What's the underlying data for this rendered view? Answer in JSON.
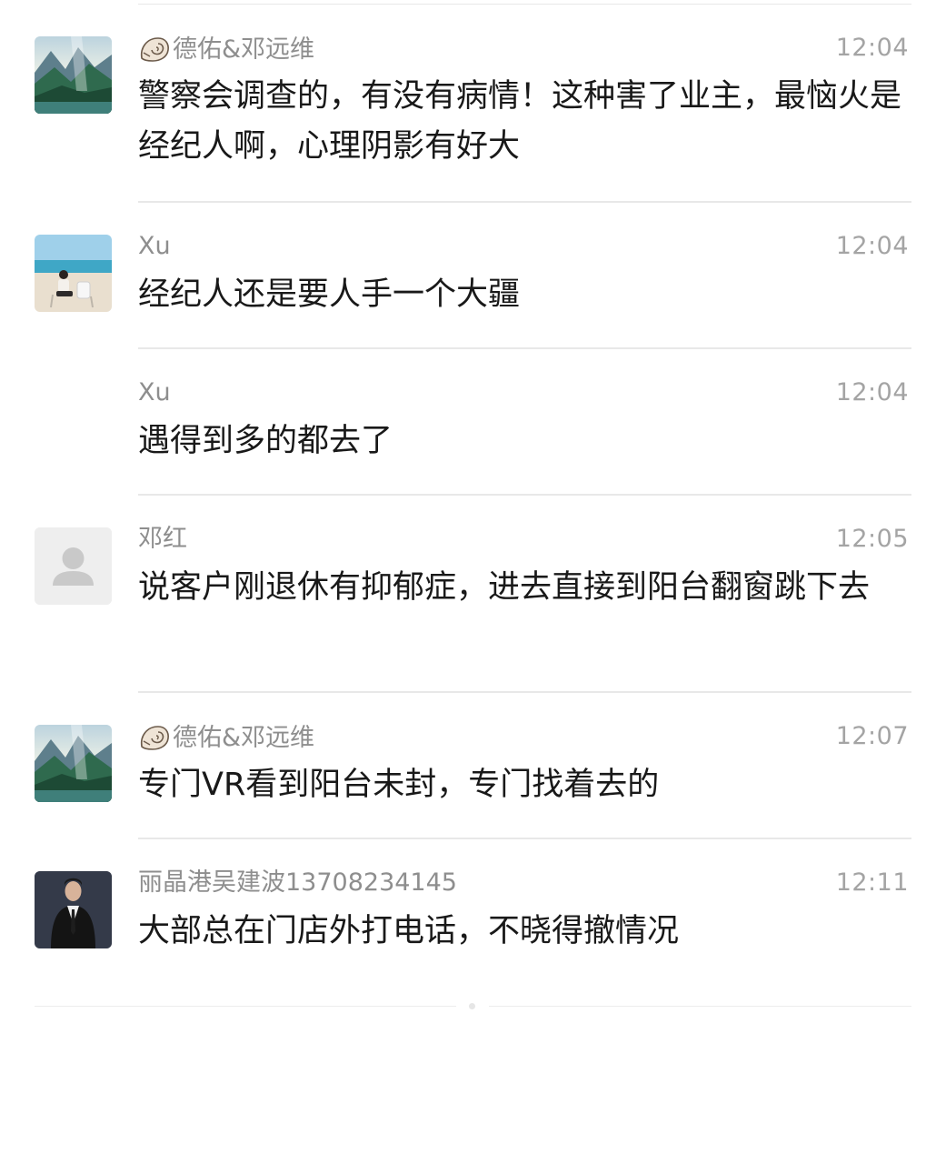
{
  "messages": [
    {
      "sender": "德佑&邓远维",
      "time": "12:04",
      "text": "警察会调查的，有没有病情！这种害了业主，最恼火是经纪人啊，心理阴影有好大",
      "avatar": "landscape-avatar",
      "sender_icon": "shell-icon"
    },
    {
      "sender": "Xu",
      "time": "12:04",
      "text": "经纪人还是要人手一个大疆",
      "avatar": "beach-avatar"
    },
    {
      "sender": "Xu",
      "time": "12:04",
      "text": "遇得到多的都去了"
    },
    {
      "sender": "邓红",
      "time": "12:05",
      "text": "说客户刚退休有抑郁症，进去直接到阳台翻窗跳下去",
      "avatar": "default-user-avatar"
    },
    {
      "sender": "德佑&邓远维",
      "time": "12:07",
      "text": "专门VR看到阳台未封，专门找着去的",
      "avatar": "landscape-avatar",
      "sender_icon": "shell-icon"
    },
    {
      "sender": "丽晶港吴建波13708234145",
      "time": "12:11",
      "text": "大部总在门店外打电话，不晓得撤情况",
      "avatar": "suit-man-avatar"
    }
  ],
  "colors": {
    "sender": "#8e8e8e",
    "time": "#a4a4a4",
    "text": "#191919",
    "separator": "#e8e8e8"
  }
}
